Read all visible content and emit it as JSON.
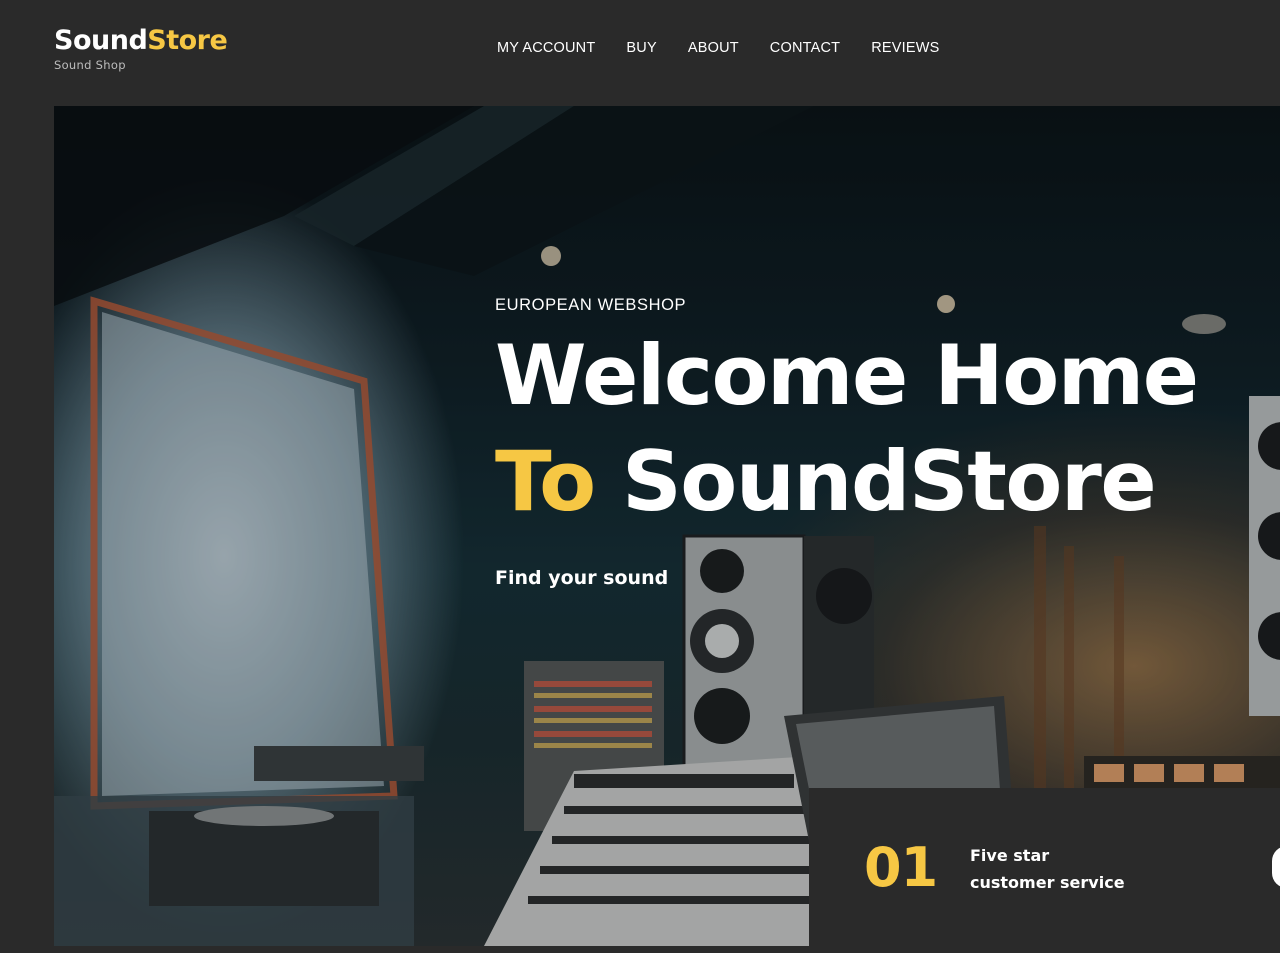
{
  "brand": {
    "name_part1": "Sound",
    "name_part2": "Store",
    "subtitle": "Sound Shop"
  },
  "nav": {
    "items": [
      {
        "label": "MY ACCOUNT"
      },
      {
        "label": "BUY"
      },
      {
        "label": "ABOUT"
      },
      {
        "label": "CONTACT"
      },
      {
        "label": "REVIEWS"
      }
    ]
  },
  "hero": {
    "eyebrow": "EUROPEAN WEBSHOP",
    "headline_line1": "Welcome Home",
    "headline_accent": "To",
    "headline_line2_rest": " SoundStore",
    "tagline": "Find your sound",
    "image_subject": "recording studio"
  },
  "feature": {
    "number": "01",
    "label_line1": "Five star",
    "label_line2": "customer service"
  },
  "colors": {
    "accent": "#f6c744",
    "background": "#2a2a2a",
    "text": "#ffffff"
  }
}
